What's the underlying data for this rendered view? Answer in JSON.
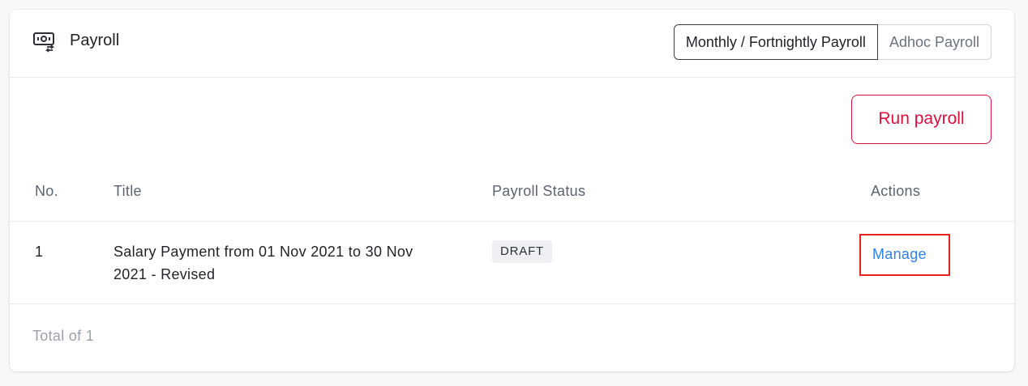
{
  "header": {
    "icon": "payroll-cash-icon",
    "title": "Payroll",
    "segments": [
      {
        "label": "Monthly / Fortnightly Payroll",
        "active": true
      },
      {
        "label": "Adhoc Payroll",
        "active": false
      }
    ]
  },
  "actions": {
    "run_payroll_label": "Run payroll"
  },
  "table": {
    "columns": [
      "No.",
      "Title",
      "Payroll Status",
      "Actions"
    ],
    "rows": [
      {
        "no": "1",
        "title": "Salary Payment from 01 Nov 2021 to 30 Nov 2021 - Revised",
        "status": "DRAFT",
        "action": "Manage"
      }
    ]
  },
  "footer": {
    "total_text": "Total of 1"
  },
  "colors": {
    "accent_red": "#e0103d",
    "link_blue": "#2f80ed",
    "highlight_box": "#e8221a"
  }
}
